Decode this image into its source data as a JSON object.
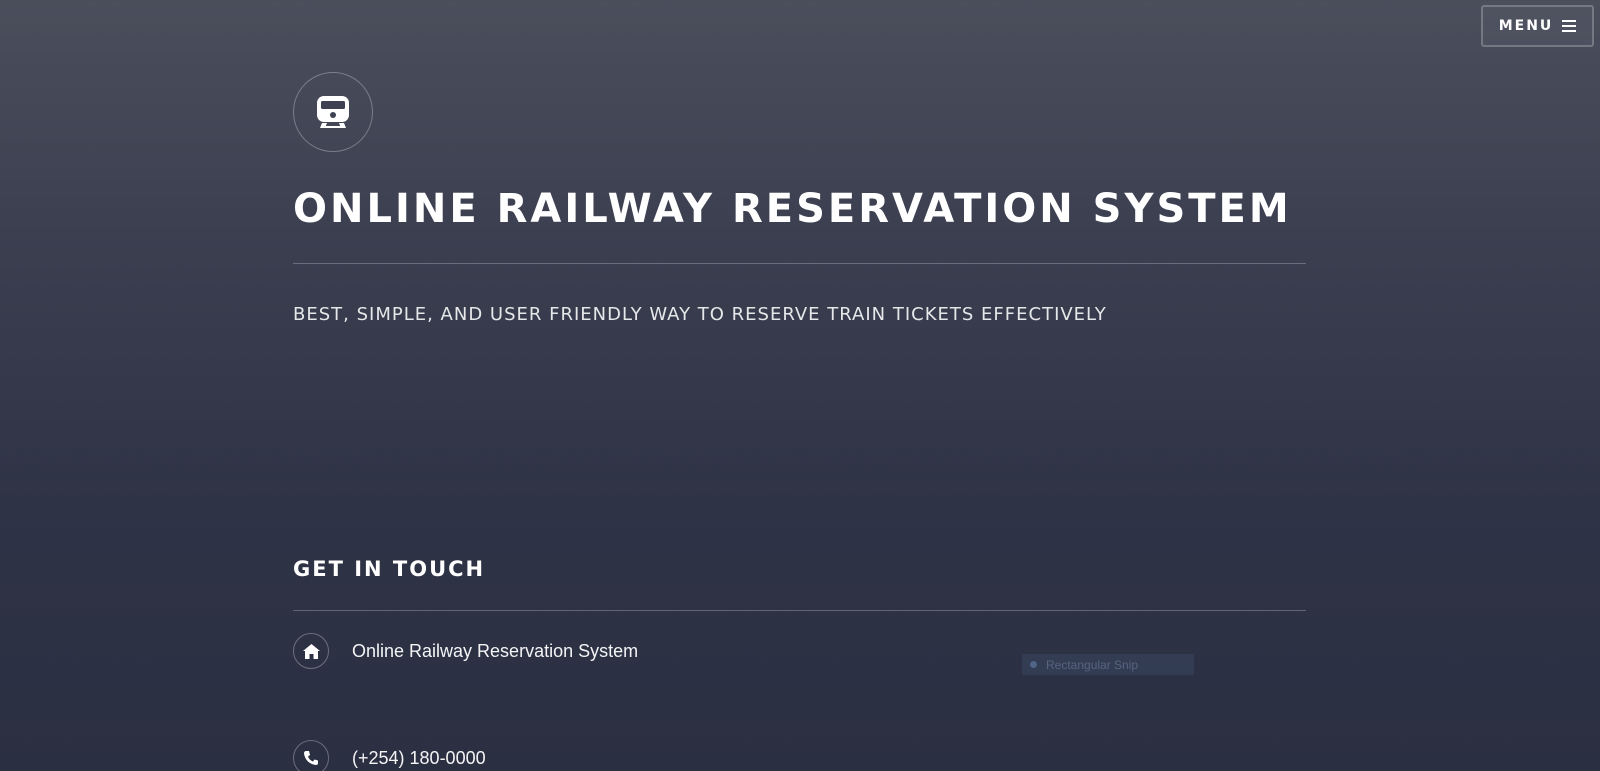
{
  "header": {
    "menu_label": "MENU",
    "menu_icon": "hamburger-icon"
  },
  "hero": {
    "icon": "train-icon",
    "title": "ONLINE RAILWAY RESERVATION SYSTEM",
    "subtitle": "BEST, SIMPLE, AND USER FRIENDLY WAY TO RESERVE TRAIN TICKETS EFFECTIVELY"
  },
  "contact": {
    "heading": "GET IN TOUCH",
    "items": [
      {
        "icon": "home-icon",
        "text": "Online Railway Reservation System"
      },
      {
        "icon": "phone-icon",
        "text": "(+254) 180-0000"
      }
    ]
  },
  "overlay": {
    "label": "Rectangular Snip"
  }
}
